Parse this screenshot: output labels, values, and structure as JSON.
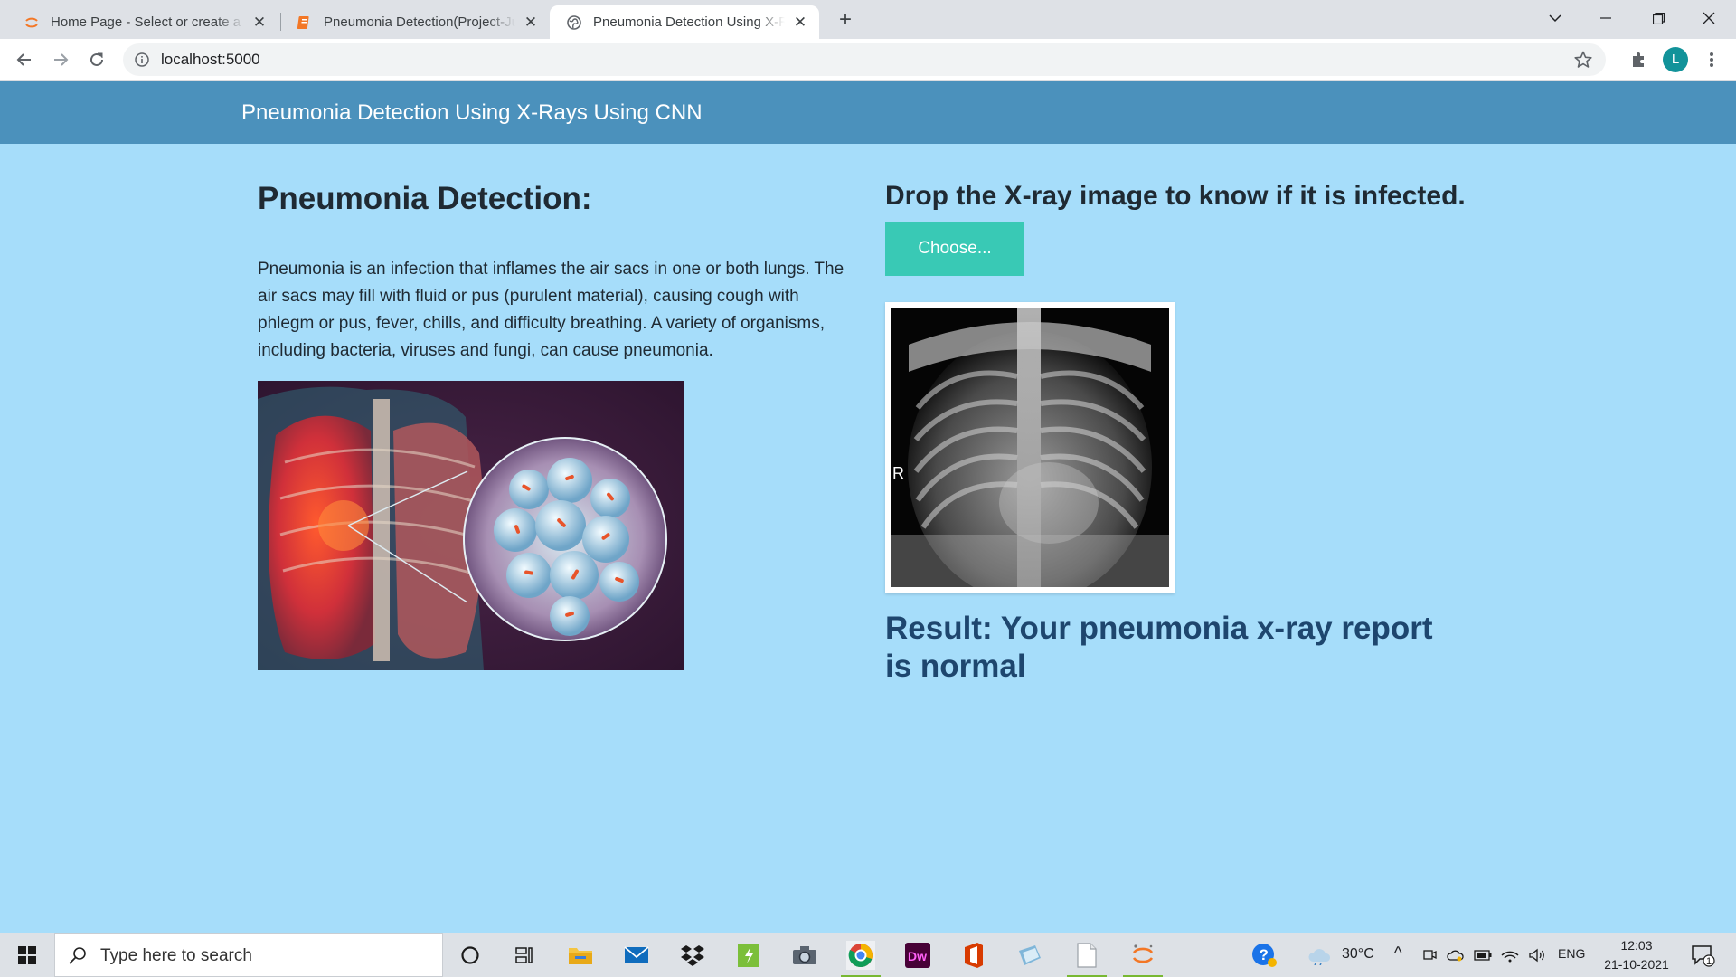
{
  "browser": {
    "tabs": [
      {
        "title": "Home Page - Select or create a notebook",
        "icon": "jupyter-icon",
        "active": false
      },
      {
        "title": "Pneumonia Detection(Project-Jupyter)",
        "icon": "notebook-icon",
        "active": false
      },
      {
        "title": "Pneumonia Detection Using X-Rays",
        "icon": "globe-icon",
        "active": true
      }
    ],
    "url": "localhost:5000",
    "profile_initial": "L",
    "colors": {
      "tabbar": "#dee1e6",
      "profile": "#12939a"
    }
  },
  "page": {
    "brand": "Pneumonia Detection Using X-Rays Using CNN",
    "left": {
      "heading": "Pneumonia Detection:",
      "description": "Pneumonia is an infection that inflames the air sacs in one or both lungs. The air sacs may fill with fluid or pus (purulent material), causing cough with phlegm or pus, fever, chills, and difficulty breathing. A variety of organisms, including bacteria, viruses and fungi, can cause pneumonia."
    },
    "right": {
      "heading": "Drop the X-ray image to know if it is infected.",
      "choose_label": "Choose...",
      "xray_marker": "R",
      "result": "Result: Your pneumonia x-ray report is normal"
    },
    "colors": {
      "background": "#a6ddfa",
      "navbar": "#4b91bc",
      "button": "#39c9b5",
      "result": "#1e466e"
    }
  },
  "taskbar": {
    "search_placeholder": "Type here to search",
    "apps": [
      "cortana-icon",
      "task-view-icon",
      "file-explorer-icon",
      "mail-icon",
      "dropbox-icon",
      "sheets-icon",
      "camera-icon",
      "chrome-icon",
      "dreamweaver-icon",
      "office-icon",
      "app-icon",
      "notepad-icon",
      "jupyter-icon"
    ],
    "weather": "30°C",
    "language": "ENG",
    "time": "12:03",
    "date": "21-10-2021",
    "notification_count": "1"
  }
}
